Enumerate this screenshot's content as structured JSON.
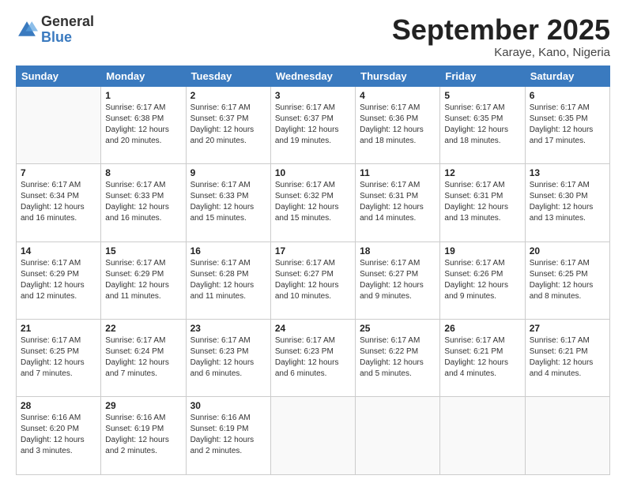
{
  "logo": {
    "general": "General",
    "blue": "Blue"
  },
  "title": "September 2025",
  "subtitle": "Karaye, Kano, Nigeria",
  "days_header": [
    "Sunday",
    "Monday",
    "Tuesday",
    "Wednesday",
    "Thursday",
    "Friday",
    "Saturday"
  ],
  "weeks": [
    [
      {
        "day": "",
        "info": ""
      },
      {
        "day": "1",
        "info": "Sunrise: 6:17 AM\nSunset: 6:38 PM\nDaylight: 12 hours\nand 20 minutes."
      },
      {
        "day": "2",
        "info": "Sunrise: 6:17 AM\nSunset: 6:37 PM\nDaylight: 12 hours\nand 20 minutes."
      },
      {
        "day": "3",
        "info": "Sunrise: 6:17 AM\nSunset: 6:37 PM\nDaylight: 12 hours\nand 19 minutes."
      },
      {
        "day": "4",
        "info": "Sunrise: 6:17 AM\nSunset: 6:36 PM\nDaylight: 12 hours\nand 18 minutes."
      },
      {
        "day": "5",
        "info": "Sunrise: 6:17 AM\nSunset: 6:35 PM\nDaylight: 12 hours\nand 18 minutes."
      },
      {
        "day": "6",
        "info": "Sunrise: 6:17 AM\nSunset: 6:35 PM\nDaylight: 12 hours\nand 17 minutes."
      }
    ],
    [
      {
        "day": "7",
        "info": "Sunrise: 6:17 AM\nSunset: 6:34 PM\nDaylight: 12 hours\nand 16 minutes."
      },
      {
        "day": "8",
        "info": "Sunrise: 6:17 AM\nSunset: 6:33 PM\nDaylight: 12 hours\nand 16 minutes."
      },
      {
        "day": "9",
        "info": "Sunrise: 6:17 AM\nSunset: 6:33 PM\nDaylight: 12 hours\nand 15 minutes."
      },
      {
        "day": "10",
        "info": "Sunrise: 6:17 AM\nSunset: 6:32 PM\nDaylight: 12 hours\nand 15 minutes."
      },
      {
        "day": "11",
        "info": "Sunrise: 6:17 AM\nSunset: 6:31 PM\nDaylight: 12 hours\nand 14 minutes."
      },
      {
        "day": "12",
        "info": "Sunrise: 6:17 AM\nSunset: 6:31 PM\nDaylight: 12 hours\nand 13 minutes."
      },
      {
        "day": "13",
        "info": "Sunrise: 6:17 AM\nSunset: 6:30 PM\nDaylight: 12 hours\nand 13 minutes."
      }
    ],
    [
      {
        "day": "14",
        "info": "Sunrise: 6:17 AM\nSunset: 6:29 PM\nDaylight: 12 hours\nand 12 minutes."
      },
      {
        "day": "15",
        "info": "Sunrise: 6:17 AM\nSunset: 6:29 PM\nDaylight: 12 hours\nand 11 minutes."
      },
      {
        "day": "16",
        "info": "Sunrise: 6:17 AM\nSunset: 6:28 PM\nDaylight: 12 hours\nand 11 minutes."
      },
      {
        "day": "17",
        "info": "Sunrise: 6:17 AM\nSunset: 6:27 PM\nDaylight: 12 hours\nand 10 minutes."
      },
      {
        "day": "18",
        "info": "Sunrise: 6:17 AM\nSunset: 6:27 PM\nDaylight: 12 hours\nand 9 minutes."
      },
      {
        "day": "19",
        "info": "Sunrise: 6:17 AM\nSunset: 6:26 PM\nDaylight: 12 hours\nand 9 minutes."
      },
      {
        "day": "20",
        "info": "Sunrise: 6:17 AM\nSunset: 6:25 PM\nDaylight: 12 hours\nand 8 minutes."
      }
    ],
    [
      {
        "day": "21",
        "info": "Sunrise: 6:17 AM\nSunset: 6:25 PM\nDaylight: 12 hours\nand 7 minutes."
      },
      {
        "day": "22",
        "info": "Sunrise: 6:17 AM\nSunset: 6:24 PM\nDaylight: 12 hours\nand 7 minutes."
      },
      {
        "day": "23",
        "info": "Sunrise: 6:17 AM\nSunset: 6:23 PM\nDaylight: 12 hours\nand 6 minutes."
      },
      {
        "day": "24",
        "info": "Sunrise: 6:17 AM\nSunset: 6:23 PM\nDaylight: 12 hours\nand 6 minutes."
      },
      {
        "day": "25",
        "info": "Sunrise: 6:17 AM\nSunset: 6:22 PM\nDaylight: 12 hours\nand 5 minutes."
      },
      {
        "day": "26",
        "info": "Sunrise: 6:17 AM\nSunset: 6:21 PM\nDaylight: 12 hours\nand 4 minutes."
      },
      {
        "day": "27",
        "info": "Sunrise: 6:17 AM\nSunset: 6:21 PM\nDaylight: 12 hours\nand 4 minutes."
      }
    ],
    [
      {
        "day": "28",
        "info": "Sunrise: 6:16 AM\nSunset: 6:20 PM\nDaylight: 12 hours\nand 3 minutes."
      },
      {
        "day": "29",
        "info": "Sunrise: 6:16 AM\nSunset: 6:19 PM\nDaylight: 12 hours\nand 2 minutes."
      },
      {
        "day": "30",
        "info": "Sunrise: 6:16 AM\nSunset: 6:19 PM\nDaylight: 12 hours\nand 2 minutes."
      },
      {
        "day": "",
        "info": ""
      },
      {
        "day": "",
        "info": ""
      },
      {
        "day": "",
        "info": ""
      },
      {
        "day": "",
        "info": ""
      }
    ]
  ]
}
